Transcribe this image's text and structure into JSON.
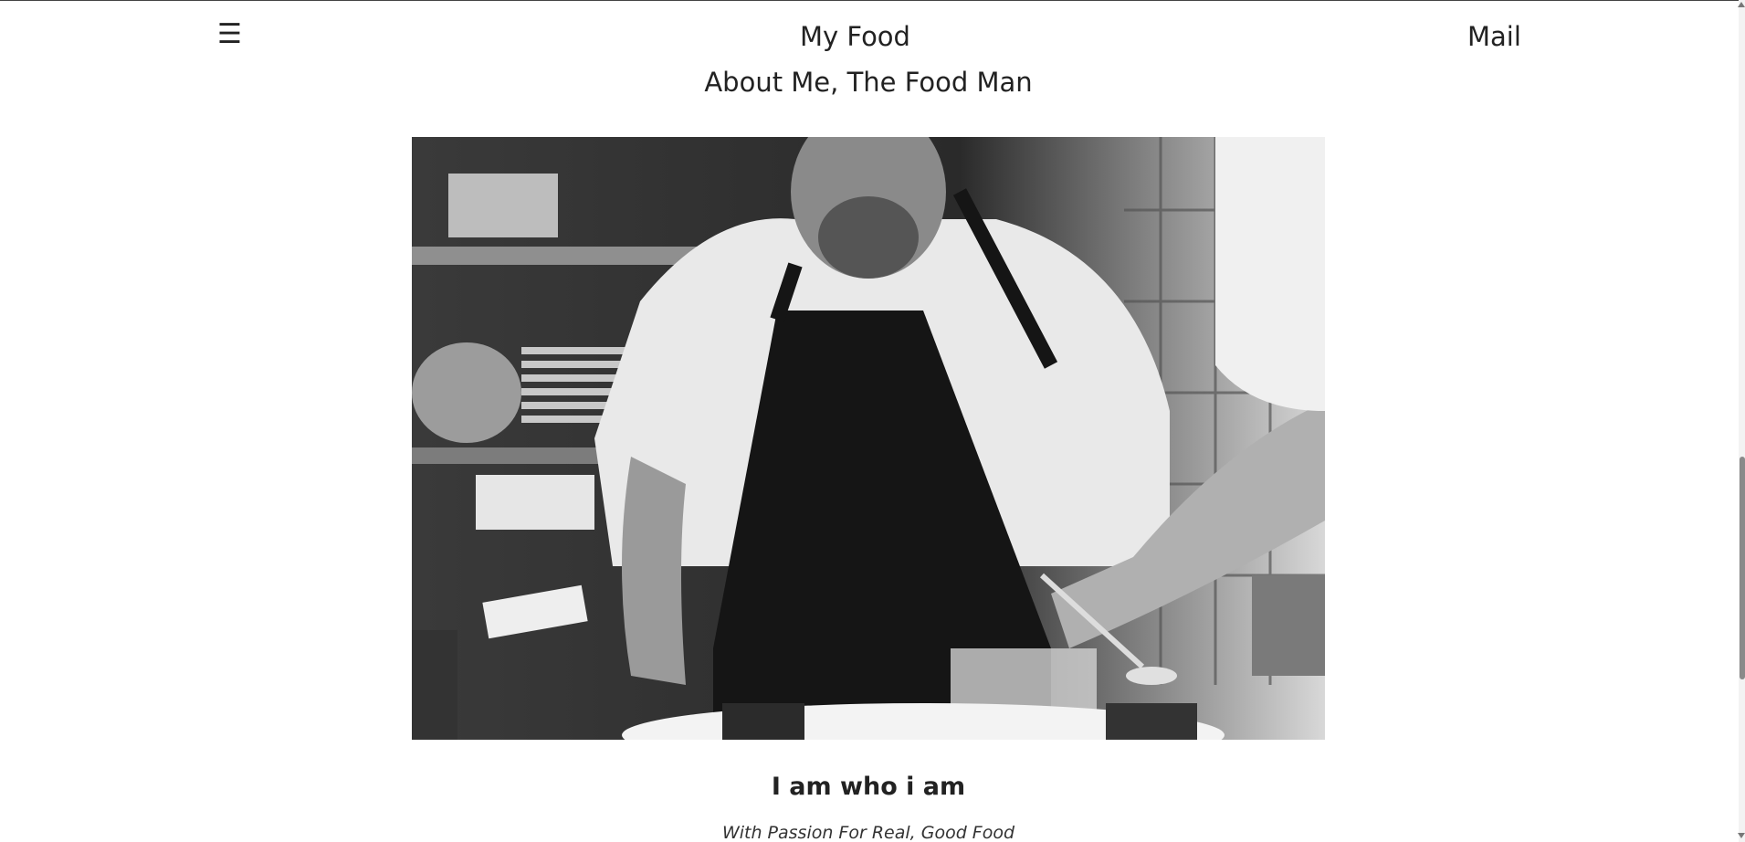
{
  "header": {
    "menu_icon": "hamburger-menu-icon",
    "menu_glyph": "☰",
    "site_title": "My Food",
    "mail_label": "Mail"
  },
  "main": {
    "heading": "About Me, The Food Man",
    "hero_image": {
      "subject": "chef-plating-food-photo",
      "style": "black-and-white"
    },
    "caption_title": "I am who i am",
    "caption_subtitle": "With Passion For Real, Good Food"
  },
  "colors": {
    "text": "#222222",
    "background": "#ffffff"
  }
}
